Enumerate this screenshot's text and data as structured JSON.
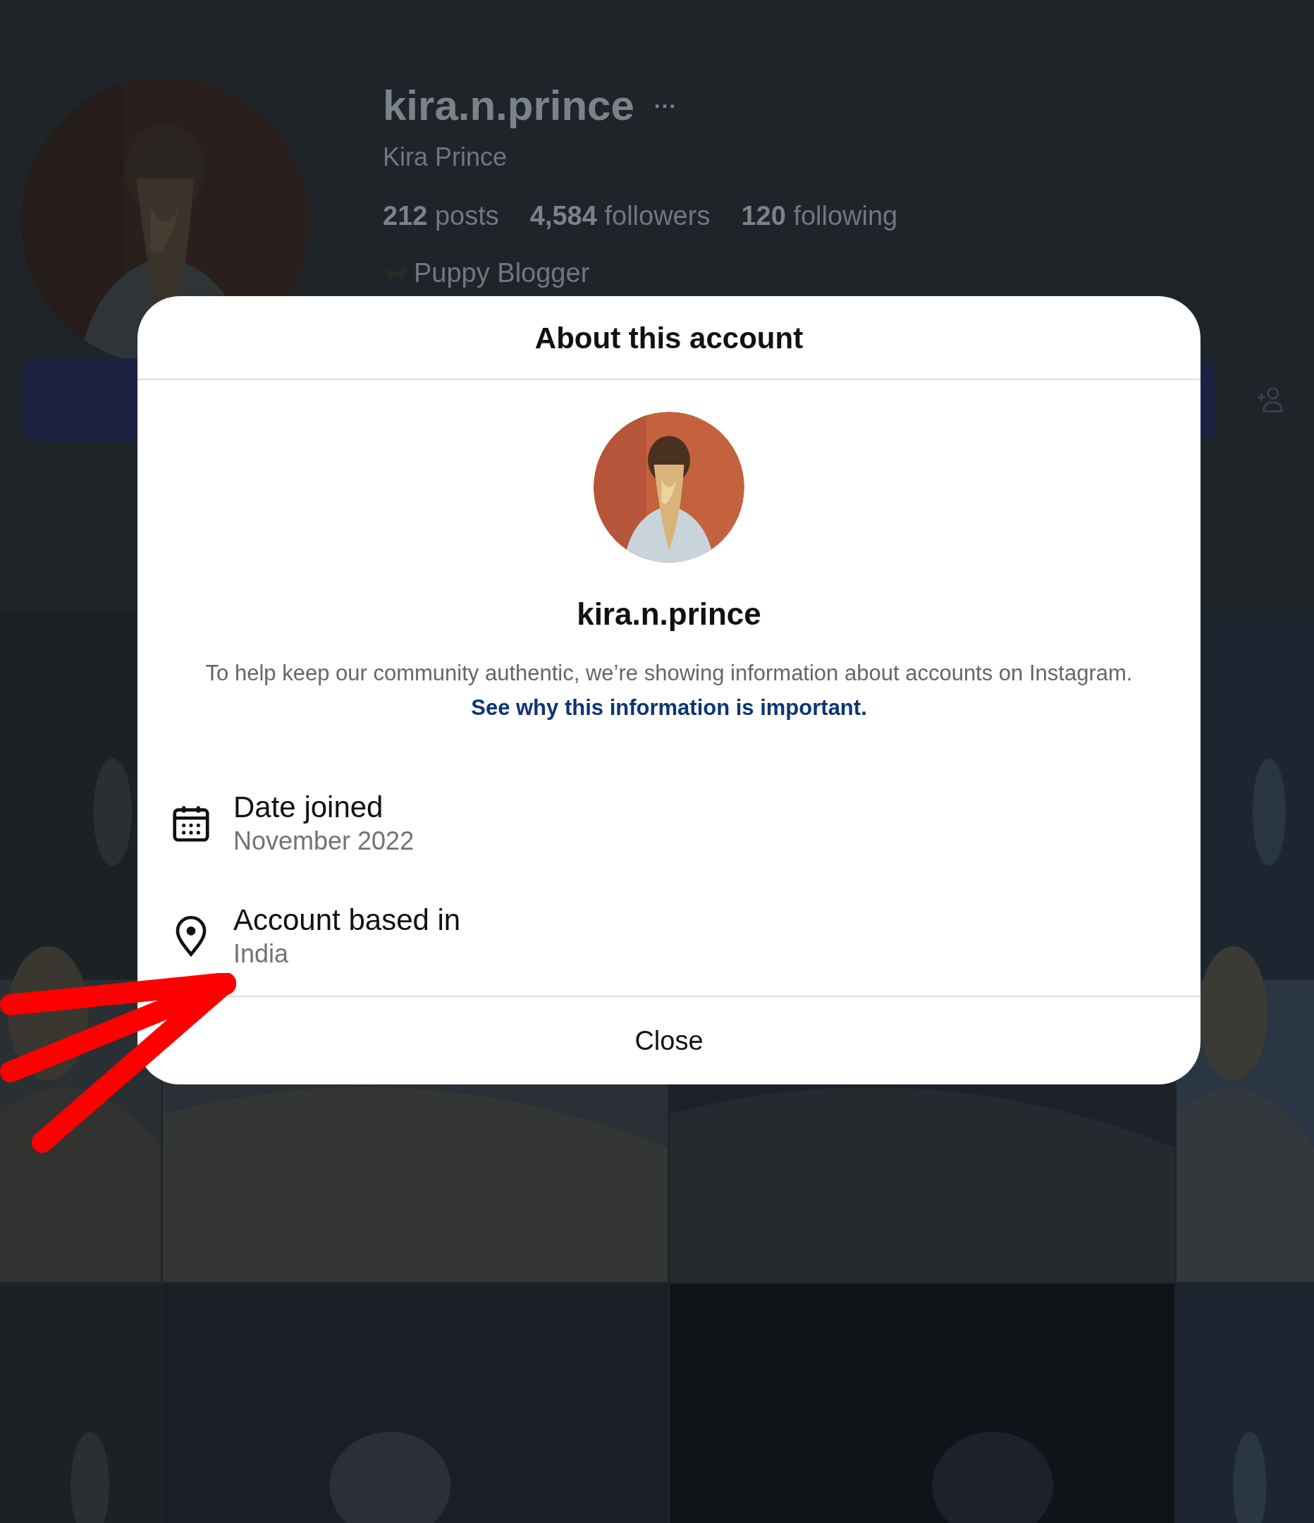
{
  "profile": {
    "username": "kira.n.prince",
    "more": "···",
    "full_name": "Kira Prince",
    "stats": [
      {
        "count": "212",
        "label": "posts"
      },
      {
        "count": "4,584",
        "label": "followers"
      },
      {
        "count": "120",
        "label": "following"
      }
    ],
    "bio": "Puppy Blogger"
  },
  "dialog": {
    "title": "About this account",
    "username": "kira.n.prince",
    "description": "To help keep our community authentic, we’re showing information about accounts on Instagram. ",
    "link": "See why this information is important.",
    "details": [
      {
        "kind": "date",
        "label": "Date joined",
        "value": "November 2022"
      },
      {
        "kind": "location",
        "label": "Account based in",
        "value": "India"
      }
    ],
    "close": "Close"
  }
}
